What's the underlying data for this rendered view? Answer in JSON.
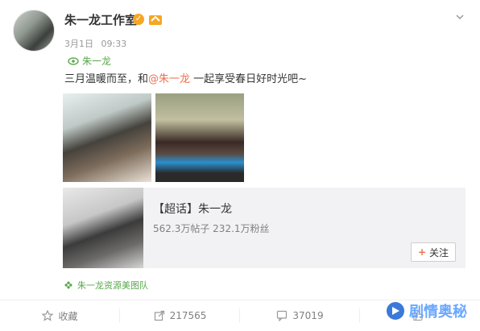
{
  "post": {
    "author": "朱一龙工作室",
    "date": "3月1日",
    "time": "09:33",
    "location_tag": "朱一龙",
    "text_before": "三月温暖而至，和",
    "mention": "@朱一龙",
    "text_after": " 一起享受春日好时光吧~",
    "source": "朱一龙资源美图队"
  },
  "topic_card": {
    "title": "【超话】朱一龙",
    "stats": "562.3万帖子 232.1万粉丝",
    "follow_plus": "+",
    "follow_label": "关注"
  },
  "actions": [
    {
      "label": "收藏",
      "icon": "star-icon"
    },
    {
      "label": "217565",
      "icon": "share-icon"
    },
    {
      "label": "37019",
      "icon": "comment-icon"
    },
    {
      "label": "",
      "icon": "like-icon"
    }
  ],
  "watermark": "剧情奥秘",
  "colors": {
    "accent": "#eb7350",
    "green": "#5aa84d",
    "watermark": "#6aa7ff"
  }
}
